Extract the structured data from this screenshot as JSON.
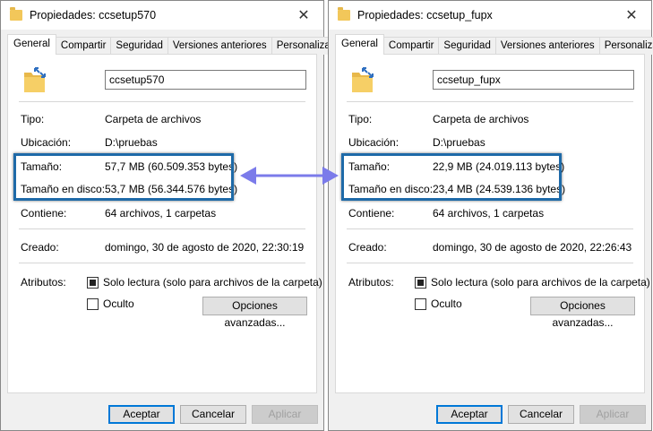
{
  "colors": {
    "highlight_border": "#1e6aa8",
    "arrow": "#7b7bea",
    "primary_button_border": "#0078d7",
    "folder": "#f2c75a"
  },
  "icons": {
    "title_folder": "folder-icon",
    "big_folder": "shortcut-folder-icon",
    "close": "close-icon",
    "arrow": "double-arrow-icon"
  },
  "dialogs": [
    {
      "title": "Propiedades: ccsetup570",
      "close": "✕",
      "tabs": [
        "General",
        "Compartir",
        "Seguridad",
        "Versiones anteriores",
        "Personalizar"
      ],
      "name_value": "ccsetup570",
      "props": {
        "tipo": {
          "label": "Tipo:",
          "value": "Carpeta de archivos"
        },
        "ubicacion": {
          "label": "Ubicación:",
          "value": "D:\\pruebas"
        },
        "tamano": {
          "label": "Tamaño:",
          "value": "57,7 MB (60.509.353 bytes)"
        },
        "tamano_disco": {
          "label": "Tamaño en disco:",
          "value": "53,7 MB (56.344.576 bytes)"
        },
        "contiene": {
          "label": "Contiene:",
          "value": "64 archivos, 1 carpetas"
        },
        "creado": {
          "label": "Creado:",
          "value": "domingo, 30 de agosto de 2020, 22:30:19"
        }
      },
      "atributos": {
        "label": "Atributos:",
        "solo_lectura": "Solo lectura (solo para archivos de la carpeta)",
        "oculto": "Oculto",
        "opciones": "Opciones avanzadas..."
      },
      "buttons": {
        "aceptar": "Aceptar",
        "cancelar": "Cancelar",
        "aplicar": "Aplicar"
      }
    },
    {
      "title": "Propiedades: ccsetup_fupx",
      "close": "✕",
      "tabs": [
        "General",
        "Compartir",
        "Seguridad",
        "Versiones anteriores",
        "Personalizar"
      ],
      "name_value": "ccsetup_fupx",
      "props": {
        "tipo": {
          "label": "Tipo:",
          "value": "Carpeta de archivos"
        },
        "ubicacion": {
          "label": "Ubicación:",
          "value": "D:\\pruebas"
        },
        "tamano": {
          "label": "Tamaño:",
          "value": "22,9 MB (24.019.113 bytes)"
        },
        "tamano_disco": {
          "label": "Tamaño en disco:",
          "value": "23,4 MB (24.539.136 bytes)"
        },
        "contiene": {
          "label": "Contiene:",
          "value": "64 archivos, 1 carpetas"
        },
        "creado": {
          "label": "Creado:",
          "value": "domingo, 30 de agosto de 2020, 22:26:43"
        }
      },
      "atributos": {
        "label": "Atributos:",
        "solo_lectura": "Solo lectura (solo para archivos de la carpeta)",
        "oculto": "Oculto",
        "opciones": "Opciones avanzadas..."
      },
      "buttons": {
        "aceptar": "Aceptar",
        "cancelar": "Cancelar",
        "aplicar": "Aplicar"
      }
    }
  ]
}
